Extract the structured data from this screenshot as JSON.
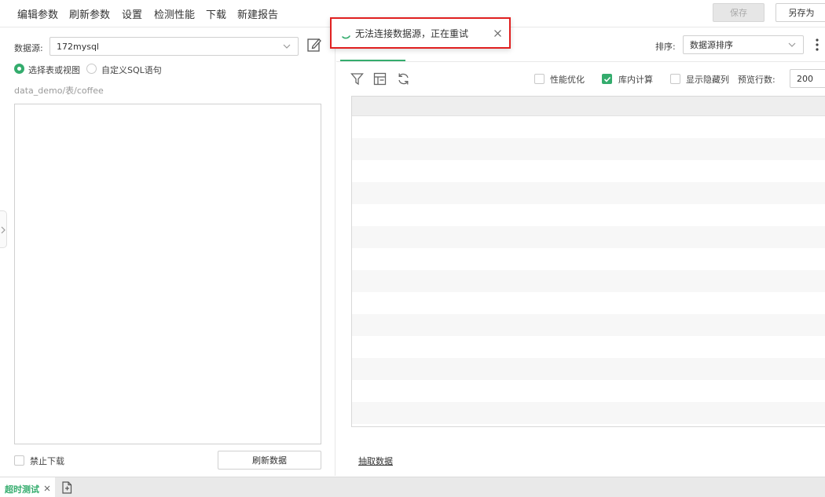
{
  "menu": {
    "items": [
      "编辑参数",
      "刷新参数",
      "设置",
      "检测性能",
      "下载",
      "新建报告"
    ],
    "save_label": "保存",
    "save_as_label": "另存为"
  },
  "left": {
    "datasource_label": "数据源:",
    "datasource_value": "172mysql",
    "radio_table": "选择表或视图",
    "radio_sql": "自定义SQL语句",
    "path": "data_demo/表/coffee",
    "disable_download": "禁止下载",
    "refresh_button": "刷新数据"
  },
  "right": {
    "sort_label": "排序:",
    "sort_value": "数据源排序",
    "perf_opt": "性能优化",
    "in_db_calc": "库内计算",
    "show_hidden": "显示隐藏列",
    "preview_rows_label": "预览行数:",
    "preview_rows_value": "200",
    "extract_link": "抽取数据"
  },
  "toast": {
    "message": "无法连接数据源，正在重试"
  },
  "bottom": {
    "active_tab": "超时测试"
  },
  "colors": {
    "accent": "#34ac6d",
    "toast_border": "#e02020"
  }
}
